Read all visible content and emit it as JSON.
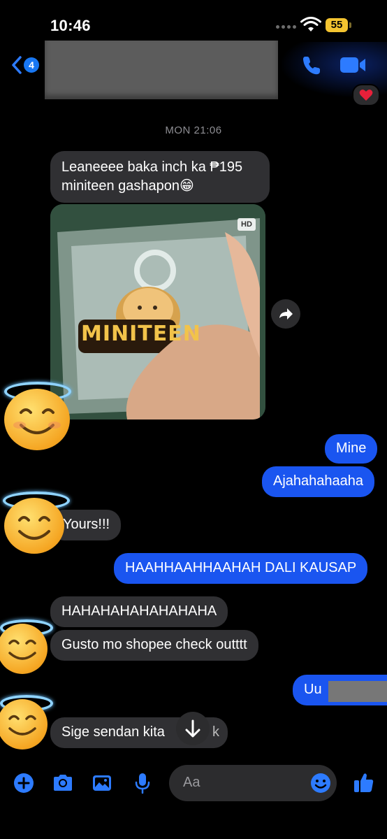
{
  "status": {
    "time": "10:46",
    "battery": "55"
  },
  "header": {
    "unread_count": "4"
  },
  "thread": {
    "date_label": "MON 21:06",
    "m1_line1": "Leaneeee baka inch ka ₱195",
    "m1_line2": "miniteen gashapon😁",
    "photo_hd": "HD",
    "photo_label": "MINITEEN",
    "out1": "Mine",
    "out2": "Ajahahahaaha",
    "in2": "Yours!!!",
    "out3": "HAAHHAAHHAAHAH DALI KAUSAP",
    "in3": "HAHAHAHAHAHAHAHA",
    "in4": "Gusto mo shopee check outttt",
    "out4": "Uu",
    "in5a": "Sige sendan kita",
    "in5b": "k"
  },
  "composer": {
    "placeholder": "Aa"
  },
  "colors": {
    "accent": "#1a55f0",
    "incoming": "#303033",
    "reaction": "heart"
  },
  "icons": [
    "back-chevron-icon",
    "call-icon",
    "video-call-icon",
    "share-icon",
    "plus-icon",
    "camera-icon",
    "gallery-icon",
    "microphone-icon",
    "emoji-icon",
    "thumbs-up-icon",
    "arrow-down-icon"
  ]
}
